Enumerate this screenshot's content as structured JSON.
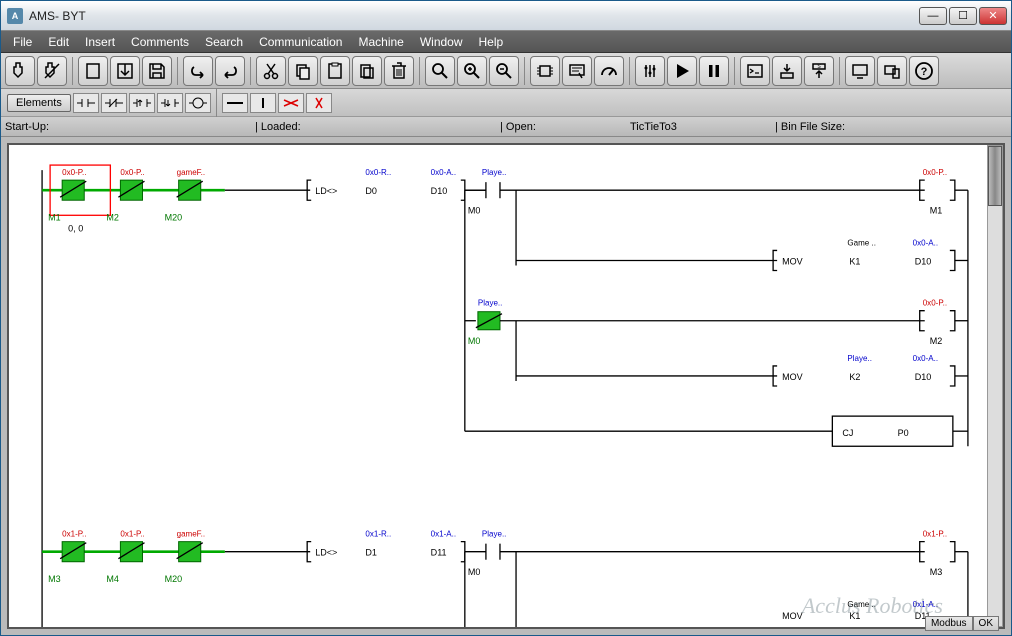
{
  "title": "AMS- BYT",
  "menu": [
    "File",
    "Edit",
    "Insert",
    "Comments",
    "Search",
    "Communication",
    "Machine",
    "Window",
    "Help"
  ],
  "toolbar_icons": [
    "usb",
    "usb-x",
    "sep",
    "new",
    "open",
    "save",
    "sep",
    "undo",
    "redo",
    "sep",
    "cut",
    "copy",
    "paste",
    "duplicate",
    "delete",
    "sep",
    "zoom",
    "zoom-in",
    "zoom-out",
    "sep",
    "chip",
    "stamp",
    "gauge",
    "sep",
    "sliders",
    "play",
    "pause",
    "sep",
    "cmd",
    "download",
    "upload",
    "sep",
    "monitor",
    "teach",
    "help"
  ],
  "elements_label": "Elements",
  "element_icons": [
    "no-contact",
    "nc-contact",
    "rising",
    "falling",
    "coil",
    "sep",
    "hline",
    "vline",
    "del-red",
    "del-red2"
  ],
  "status": {
    "startup": "Start-Up:",
    "loaded": "| Loaded:",
    "open": "| Open:",
    "openval": "TicTieTo3",
    "binfile": "| Bin File Size:"
  },
  "footer": [
    "Modbus",
    "OK"
  ],
  "watermark": "Acclus Robotics",
  "rung0": {
    "m1_top": "0x0-P..",
    "m2_top": "0x0-P..",
    "m20_top": "gameF..",
    "m1": "M1",
    "m2": "M2",
    "m20": "M20",
    "coord": "0, 0",
    "ld": "LD<>",
    "d0_top": "0x0-R..",
    "d0": "D0",
    "d10_top": "0x0-A..",
    "d10": "D10",
    "playe": "Playe..",
    "m0": "M0",
    "out_m1_top": "0x0-P..",
    "out_m1": "M1",
    "mov": "MOV",
    "k1": "K1",
    "k1_top": "Game ..",
    "d10b": "D10",
    "d10b_top": "0x0-A..",
    "playe2": "Playe..",
    "m0b": "M0",
    "out_m2": "M2",
    "out_m2_top": "0x0-P..",
    "k2": "K2",
    "k2_top": "Playe..",
    "d10c": "D10",
    "d10c_top": "0x0-A..",
    "cj": "CJ",
    "p0": "P0"
  },
  "rung1": {
    "m3_top": "0x1-P..",
    "m4_top": "0x1-P..",
    "m20_top": "gameF..",
    "m3": "M3",
    "m4": "M4",
    "m20": "M20",
    "ld": "LD<>",
    "d1_top": "0x1-R..",
    "d1": "D1",
    "d11_top": "0x1-A..",
    "d11": "D11",
    "playe": "Playe..",
    "m0": "M0",
    "out_m3_top": "0x1-P..",
    "out_m3": "M3",
    "k1_top": "Game ..",
    "k1": "K1",
    "d11b_top": "0x1-A..",
    "d11b": "D11",
    "mov": "MOV"
  }
}
